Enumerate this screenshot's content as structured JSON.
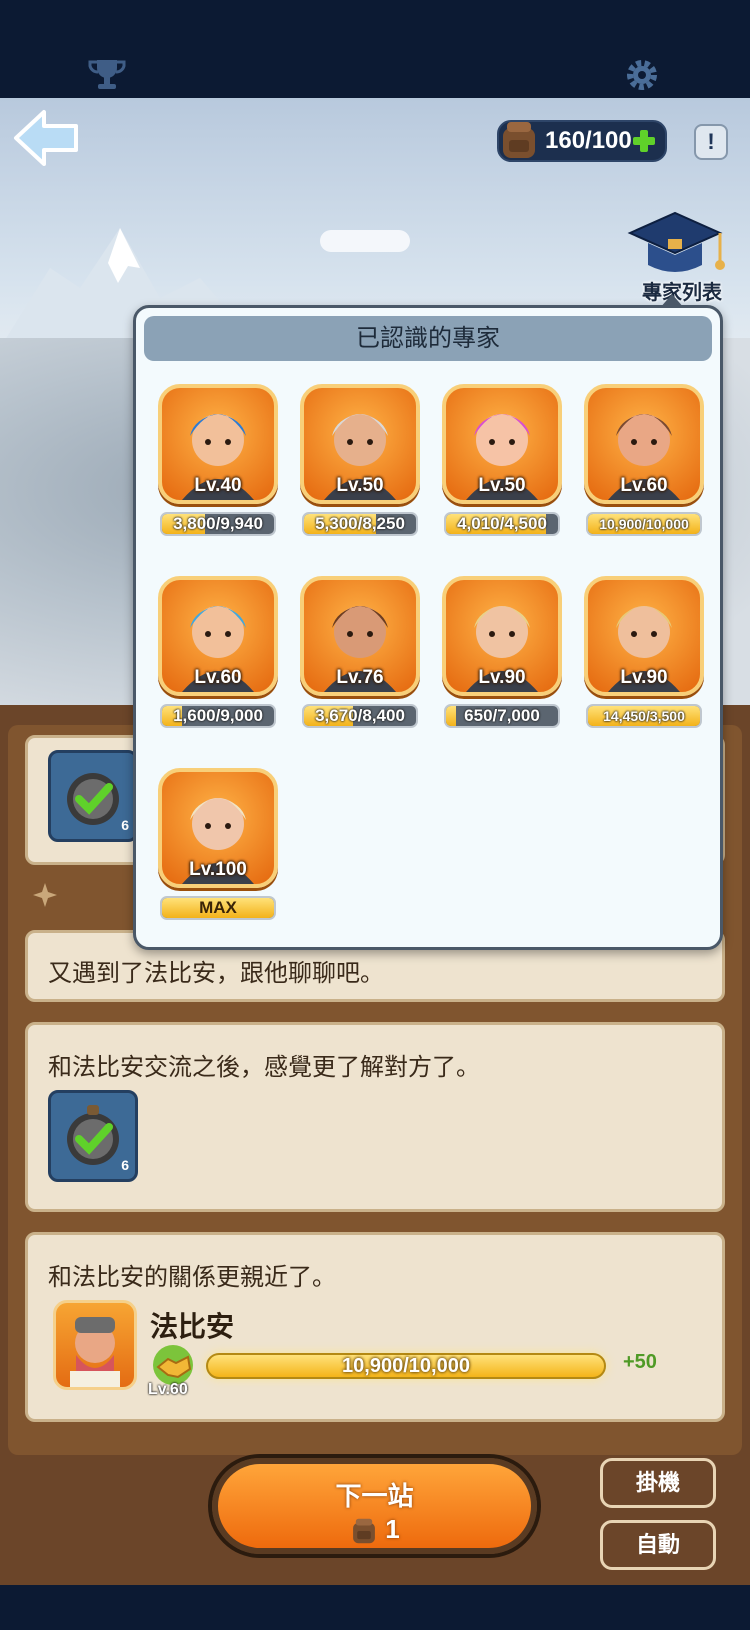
{
  "resources": {
    "bag_count": "160/100"
  },
  "popup": {
    "header": "已認識的專家",
    "experts": [
      {
        "level": "Lv.40",
        "xp": "3,800/9,940",
        "progress": 0.38,
        "hair": "#2a7bd6",
        "skin": "#f2c09a"
      },
      {
        "level": "Lv.50",
        "xp": "5,300/8,250",
        "progress": 0.64,
        "hair": "#d9d9d9",
        "skin": "#e6b08c"
      },
      {
        "level": "Lv.50",
        "xp": "4,010/4,500",
        "progress": 0.89,
        "hair": "#d84fd0",
        "skin": "#f6c3a6"
      },
      {
        "level": "Lv.60",
        "xp": "10,900/10,000",
        "progress": 1.0,
        "hair": "#7a4a32",
        "skin": "#e9a785"
      },
      {
        "level": "Lv.60",
        "xp": "1,600/9,000",
        "progress": 0.18,
        "hair": "#3fa8e0",
        "skin": "#f2c09a"
      },
      {
        "level": "Lv.76",
        "xp": "3,670/8,400",
        "progress": 0.44,
        "hair": "#6b3d22",
        "skin": "#d99a76"
      },
      {
        "level": "Lv.90",
        "xp": "650/7,000",
        "progress": 0.09,
        "hair": "#e9d28a",
        "skin": "#f0c3a2"
      },
      {
        "level": "Lv.90",
        "xp": "14,450/3,500",
        "progress": 1.0,
        "hair": "#e8c977",
        "skin": "#efbf9c"
      },
      {
        "level": "Lv.100",
        "xp": "MAX",
        "progress": 1.0,
        "hair": "#f1e4c4",
        "skin": "#f0c6ab"
      }
    ]
  },
  "expert_list_label": "專家列表",
  "cards": {
    "card1_text": "又遇到了法比安，跟他聊聊吧。",
    "card2_text": "和法比安交流之後，感覺更了解對方了。",
    "card2_badge_count": "6",
    "card0_badge_count": "6",
    "card3_text": "和法比安的關係更親近了。",
    "relation": {
      "name": "法比安",
      "level": "Lv.60",
      "xp": "10,900/10,000",
      "gain": "+50"
    }
  },
  "buttons": {
    "next_label": "下一站",
    "next_cost": "1",
    "idle": "掛機",
    "auto": "自動"
  }
}
